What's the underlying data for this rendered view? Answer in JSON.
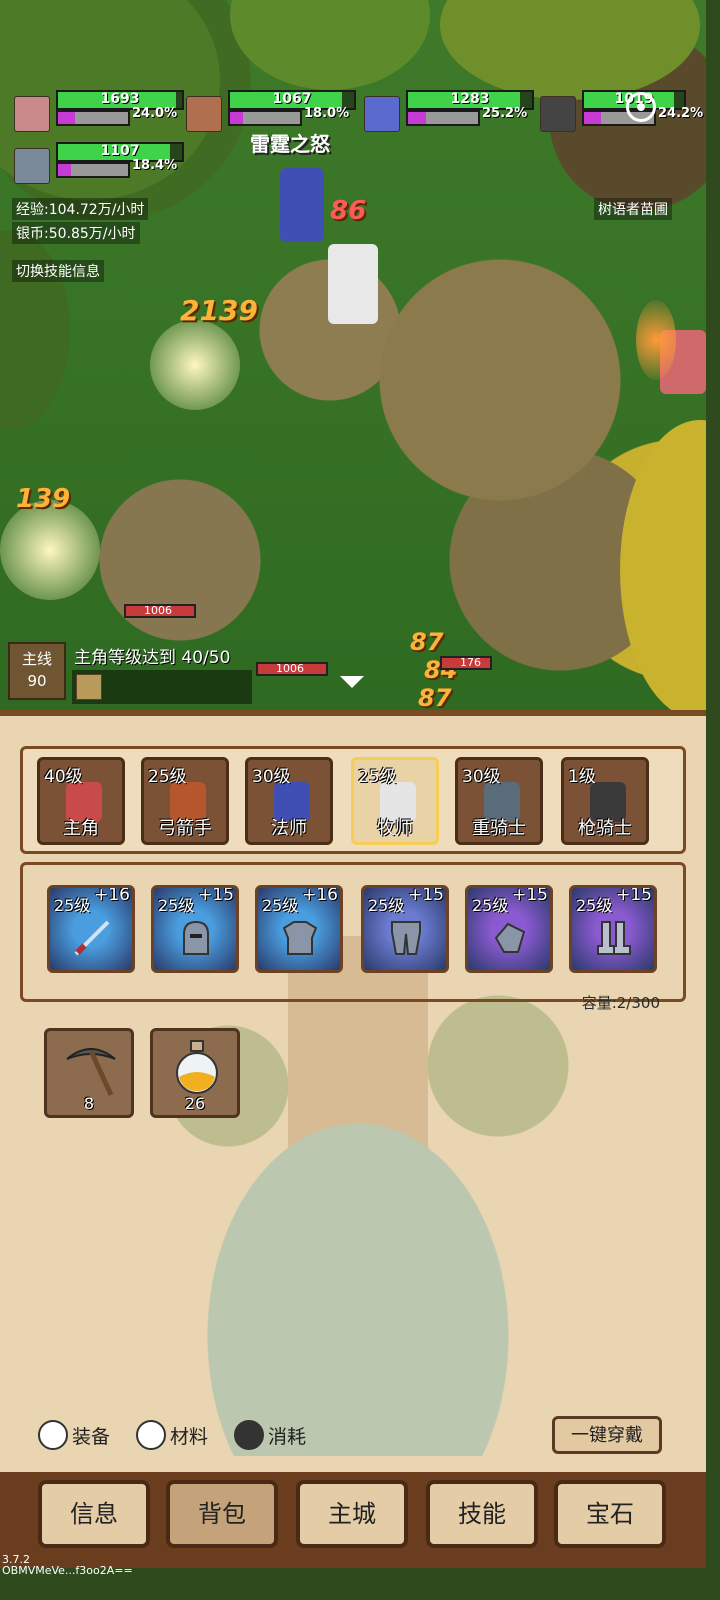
{
  "party": [
    {
      "hp": "1693",
      "hp_fraction": 0.95,
      "mp_fraction": 0.24,
      "mp_pct": "24.0%"
    },
    {
      "hp": "1067",
      "hp_fraction": 0.9,
      "mp_fraction": 0.18,
      "mp_pct": "18.0%"
    },
    {
      "hp": "1283",
      "hp_fraction": 0.9,
      "mp_fraction": 0.252,
      "mp_pct": "25.2%"
    },
    {
      "hp": "1019",
      "hp_fraction": 0.9,
      "mp_fraction": 0.242,
      "mp_pct": "24.2%"
    },
    {
      "hp": "1107",
      "hp_fraction": 0.9,
      "mp_fraction": 0.184,
      "mp_pct": "18.4%"
    }
  ],
  "stats": {
    "exp": "经验:104.72万/小时",
    "silver": "银币:50.85万/小时",
    "toggle": "切换技能信息"
  },
  "battle": {
    "skill_name": "雷霆之怒",
    "zone": "树语者苗圃",
    "damage": [
      "86",
      "2139",
      "139",
      "87",
      "84",
      "87"
    ],
    "enemy_hp": [
      "1006",
      "1006",
      "176"
    ]
  },
  "quest": {
    "tag": "主线",
    "number": "90",
    "text": "主角等级达到 40/50"
  },
  "characters": [
    {
      "level": "40级",
      "name": "主角",
      "color": "#c94a4a"
    },
    {
      "level": "25级",
      "name": "弓箭手",
      "color": "#b5562e"
    },
    {
      "level": "30级",
      "name": "法师",
      "color": "#3f4fb3"
    },
    {
      "level": "25级",
      "name": "牧师",
      "color": "#e5e5e5"
    },
    {
      "level": "30级",
      "name": "重骑士",
      "color": "#5a6b7a"
    },
    {
      "level": "1级",
      "name": "枪骑士",
      "color": "#3a3a3a"
    }
  ],
  "equipment": [
    {
      "level": "25级",
      "plus": "+16",
      "icon": "spear-icon",
      "bg": "#4a9ee0"
    },
    {
      "level": "25级",
      "plus": "+15",
      "icon": "helmet-icon",
      "bg": "#4a9ee0"
    },
    {
      "level": "25级",
      "plus": "+16",
      "icon": "chest-armor-icon",
      "bg": "#4a9ee0"
    },
    {
      "level": "25级",
      "plus": "+15",
      "icon": "leg-armor-icon",
      "bg": "#6b7bd0"
    },
    {
      "level": "25级",
      "plus": "+15",
      "icon": "gauntlet-icon",
      "bg": "#8a5ad0"
    },
    {
      "level": "25级",
      "plus": "+15",
      "icon": "boots-icon",
      "bg": "#8a5ad0"
    }
  ],
  "capacity": "容量:2/300",
  "consumables": [
    {
      "icon": "pickaxe-icon",
      "count": "8"
    },
    {
      "icon": "potion-icon",
      "count": "26"
    }
  ],
  "filters": [
    {
      "label": "装备",
      "selected": false
    },
    {
      "label": "材料",
      "selected": false
    },
    {
      "label": "消耗",
      "selected": true
    }
  ],
  "wear_button": "一键穿戴",
  "nav": [
    "信息",
    "背包",
    "主城",
    "技能",
    "宝石"
  ],
  "nav_active": "背包",
  "version": "3.7.2",
  "build_id": "OBMVMeVe...f3oo2A=="
}
